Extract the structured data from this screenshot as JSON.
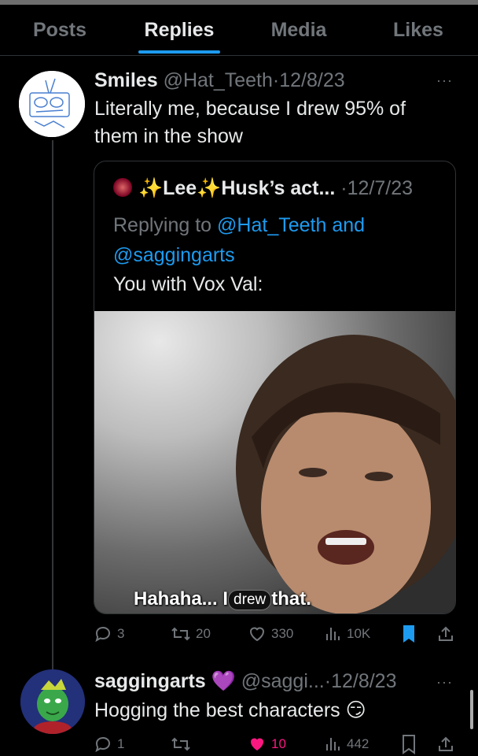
{
  "tabs": [
    {
      "label": "Posts",
      "active": false
    },
    {
      "label": "Replies",
      "active": true
    },
    {
      "label": "Media",
      "active": false
    },
    {
      "label": "Likes",
      "active": false
    }
  ],
  "tweet1": {
    "name": "Smiles",
    "handle": "@Hat_Teeth",
    "date": "12/8/23",
    "text_line1": "Literally me, because I drew 95% of",
    "text_line2": "them in the show",
    "quote": {
      "name": "✨Lee✨Husk’s act...",
      "date": "12/7/23",
      "replying_prefix": "Replying to ",
      "replying_user1": "@Hat_Teeth",
      "replying_and": " and",
      "replying_user2": "@saggingarts",
      "text": "You with Vox Val:",
      "media_caption_pre": "Hahaha... I",
      "media_caption_pill": "drew",
      "media_caption_post": "that."
    },
    "stats": {
      "replies": "3",
      "reposts": "20",
      "likes": "330",
      "views": "10K"
    }
  },
  "tweet2": {
    "name": "saggingarts",
    "badge_emoji": "💜",
    "handle": "@saggi...",
    "date": "12/8/23",
    "text": "Hogging the best characters 😏",
    "stats": {
      "replies": "1",
      "reposts": "",
      "likes": "10",
      "views": "442"
    }
  },
  "separator": "·",
  "more_label": "···",
  "colors": {
    "accent": "#1d9bf0",
    "like": "#f91880",
    "muted": "#71767b",
    "bookmark": "#1d9bf0"
  },
  "icons": [
    "reply-icon",
    "repost-icon",
    "like-icon",
    "views-icon",
    "bookmark-icon",
    "share-icon"
  ]
}
